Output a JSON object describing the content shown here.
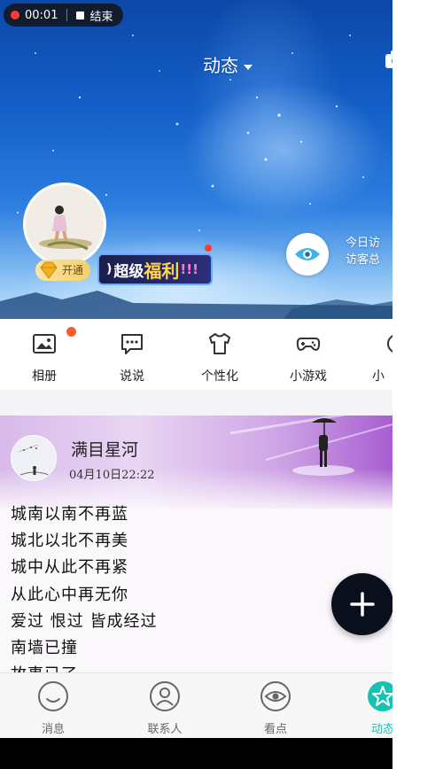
{
  "recorder": {
    "time": "00:01",
    "stop_label": "结束"
  },
  "header": {
    "title": "动态",
    "visitor_text_line1": "今日访",
    "visitor_text_line2": "访客总"
  },
  "profile": {
    "vip_label": "开通"
  },
  "promo": {
    "text_a": "超级",
    "text_b": "福利",
    "text_c": "!!!"
  },
  "shortcuts": [
    {
      "label": "相册",
      "icon": "photo-icon"
    },
    {
      "label": "说说",
      "icon": "chat-bubble-icon"
    },
    {
      "label": "个性化",
      "icon": "tshirt-icon"
    },
    {
      "label": "小游戏",
      "icon": "gamepad-icon"
    },
    {
      "label": "小",
      "icon": "partial-icon"
    }
  ],
  "post": {
    "author": "满目星河",
    "time": "04月10日22:22",
    "lines": [
      "城南以南不再蓝",
      "城北以北不再美",
      "城中从此不再紧",
      "从此心中再无你",
      "爱过 恨过 皆成经过",
      "南墙已撞",
      "故事已了"
    ]
  },
  "nav": [
    {
      "label": "消息",
      "icon": "message-icon"
    },
    {
      "label": "联系人",
      "icon": "contacts-icon"
    },
    {
      "label": "看点",
      "icon": "eye-icon"
    },
    {
      "label": "动态",
      "icon": "star-icon"
    }
  ],
  "colors": {
    "accent": "#18c2b0",
    "fab": "#0a0f1d",
    "badge_red": "#ff3b30"
  }
}
